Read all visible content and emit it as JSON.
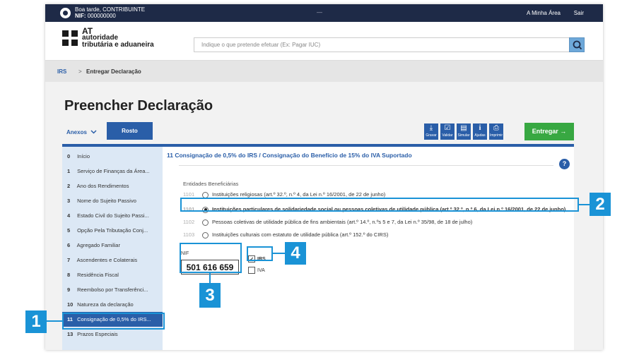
{
  "topbar": {
    "greeting": "Boa tarde, CONTRIBUINTE",
    "nif_label": "NIF:",
    "nif_value": "000000000",
    "separator": "—",
    "my_area": "A Minha Área",
    "logout": "Sair"
  },
  "logo": {
    "line1": "AT",
    "line2": "autoridade",
    "line3": "tributária e aduaneira"
  },
  "search": {
    "placeholder": "Indique o que pretende efetuar (Ex: Pagar IUC)"
  },
  "breadcrumb": {
    "root": "IRS",
    "separator": ">",
    "current": "Entregar Declaração"
  },
  "page": {
    "title": "Preencher Declaração"
  },
  "tabs": {
    "anexos": "Anexos",
    "rosto": "Rosto"
  },
  "toolbar": {
    "gravar": "Gravar",
    "validar": "Validar",
    "simular": "Simular",
    "ajudas": "Ajudas",
    "imprimir": "Imprimir",
    "entregar": "Entregar"
  },
  "sidebar": {
    "items": [
      {
        "num": "0",
        "label": "Início"
      },
      {
        "num": "1",
        "label": "Serviço de Finanças da Área..."
      },
      {
        "num": "2",
        "label": "Ano dos Rendimentos"
      },
      {
        "num": "3",
        "label": "Nome do Sujeito Passivo"
      },
      {
        "num": "4",
        "label": "Estado Civil do Sujeito Passi..."
      },
      {
        "num": "5",
        "label": "Opção Pela Tributação Conj..."
      },
      {
        "num": "6",
        "label": "Agregado Familiar"
      },
      {
        "num": "7",
        "label": "Ascendentes e Colaterais"
      },
      {
        "num": "8",
        "label": "Residência Fiscal"
      },
      {
        "num": "9",
        "label": "Reembolso por Transferênci..."
      },
      {
        "num": "10",
        "label": "Natureza da declaração"
      },
      {
        "num": "11",
        "label": "Consignação de 0,5% do IRS..."
      },
      {
        "num": "13",
        "label": "Prazos Especiais"
      }
    ]
  },
  "section": {
    "title": "11  Consignação de 0,5% do IRS / Consignação do Benefício de 15% do IVA Suportado",
    "help": "?",
    "entities_label": "Entidades Beneficiárias",
    "options": [
      {
        "code": "1101",
        "label": "Instituições religiosas (art.º 32.º, n.º 4, da Lei n.º 16/2001, de 22 de junho)"
      },
      {
        "code": "1101",
        "label": "Instituições particulares de solidariedade social ou pessoas coletivas de utilidade pública (art.º 32.º, n.º 6, da Lei n.º 16/2001, de 22 de junho)"
      },
      {
        "code": "1102",
        "label": "Pessoas coletivas de utilidade pública de fins ambientais (art.º 14.º, n.ºs 5 e 7, da Lei n.º 35/98, de 18 de julho)"
      },
      {
        "code": "1103",
        "label": "Instituições culturais com estatuto de utilidade pública (art.º 152.º do CIRS)"
      }
    ],
    "nif_label": "NIF",
    "nif_value": "501 616 659",
    "irs_label": "IRS",
    "iva_label": "IVA"
  },
  "callouts": {
    "one": "1",
    "two": "2",
    "three": "3",
    "four": "4"
  },
  "colors": {
    "brand_blue": "#2a5ea8",
    "highlight": "#1a93d6",
    "submit_green": "#38a842",
    "topbar": "#1e2a47"
  }
}
